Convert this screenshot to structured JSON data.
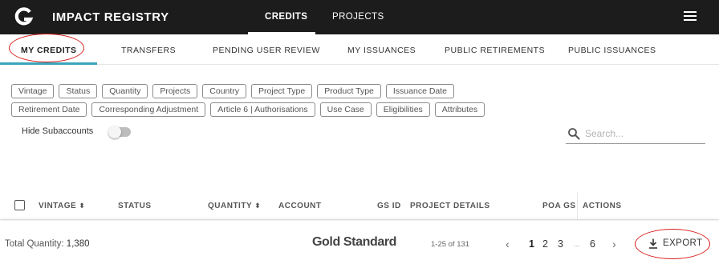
{
  "header": {
    "logo_letter": "G",
    "app_title": "IMPACT REGISTRY",
    "nav": [
      {
        "label": "CREDITS",
        "active": true
      },
      {
        "label": "PROJECTS",
        "active": false
      }
    ],
    "menu_icon": "hamburger-menu-icon"
  },
  "subtabs": [
    {
      "label": "MY CREDITS",
      "active": true
    },
    {
      "label": "TRANSFERS",
      "active": false
    },
    {
      "label": "PENDING USER REVIEW",
      "active": false
    },
    {
      "label": "MY ISSUANCES",
      "active": false
    },
    {
      "label": "PUBLIC RETIREMENTS",
      "active": false
    },
    {
      "label": "PUBLIC ISSUANCES",
      "active": false
    }
  ],
  "filters": {
    "row1": [
      "Vintage",
      "Status",
      "Quantity",
      "Projects",
      "Country",
      "Project Type",
      "Product Type",
      "Issuance Date"
    ],
    "row2": [
      "Retirement Date",
      "Corresponding Adjustment",
      "Article 6 | Authorisations",
      "Use Case",
      "Eligibilities",
      "Attributes"
    ]
  },
  "hide_subaccounts": {
    "label": "Hide Subaccounts",
    "on": false
  },
  "search": {
    "placeholder": "Search...",
    "value": ""
  },
  "table": {
    "columns": [
      "VINTAGE",
      "STATUS",
      "QUANTITY",
      "ACCOUNT",
      "GS ID",
      "PROJECT DETAILS",
      "POA GS",
      "ACTIONS"
    ]
  },
  "footer": {
    "total_label": "Total Quantity:",
    "total_value": "1,380",
    "brand": "Gold Standard",
    "range": "1-25 of 131",
    "pages": [
      "1",
      "2",
      "3",
      "6"
    ],
    "ellipsis": "...",
    "current_page": "1",
    "export_label": "EXPORT"
  },
  "colors": {
    "topbar": "#1c1c1c",
    "accent": "#3aa5b9",
    "annotation": "#d81e1e"
  }
}
